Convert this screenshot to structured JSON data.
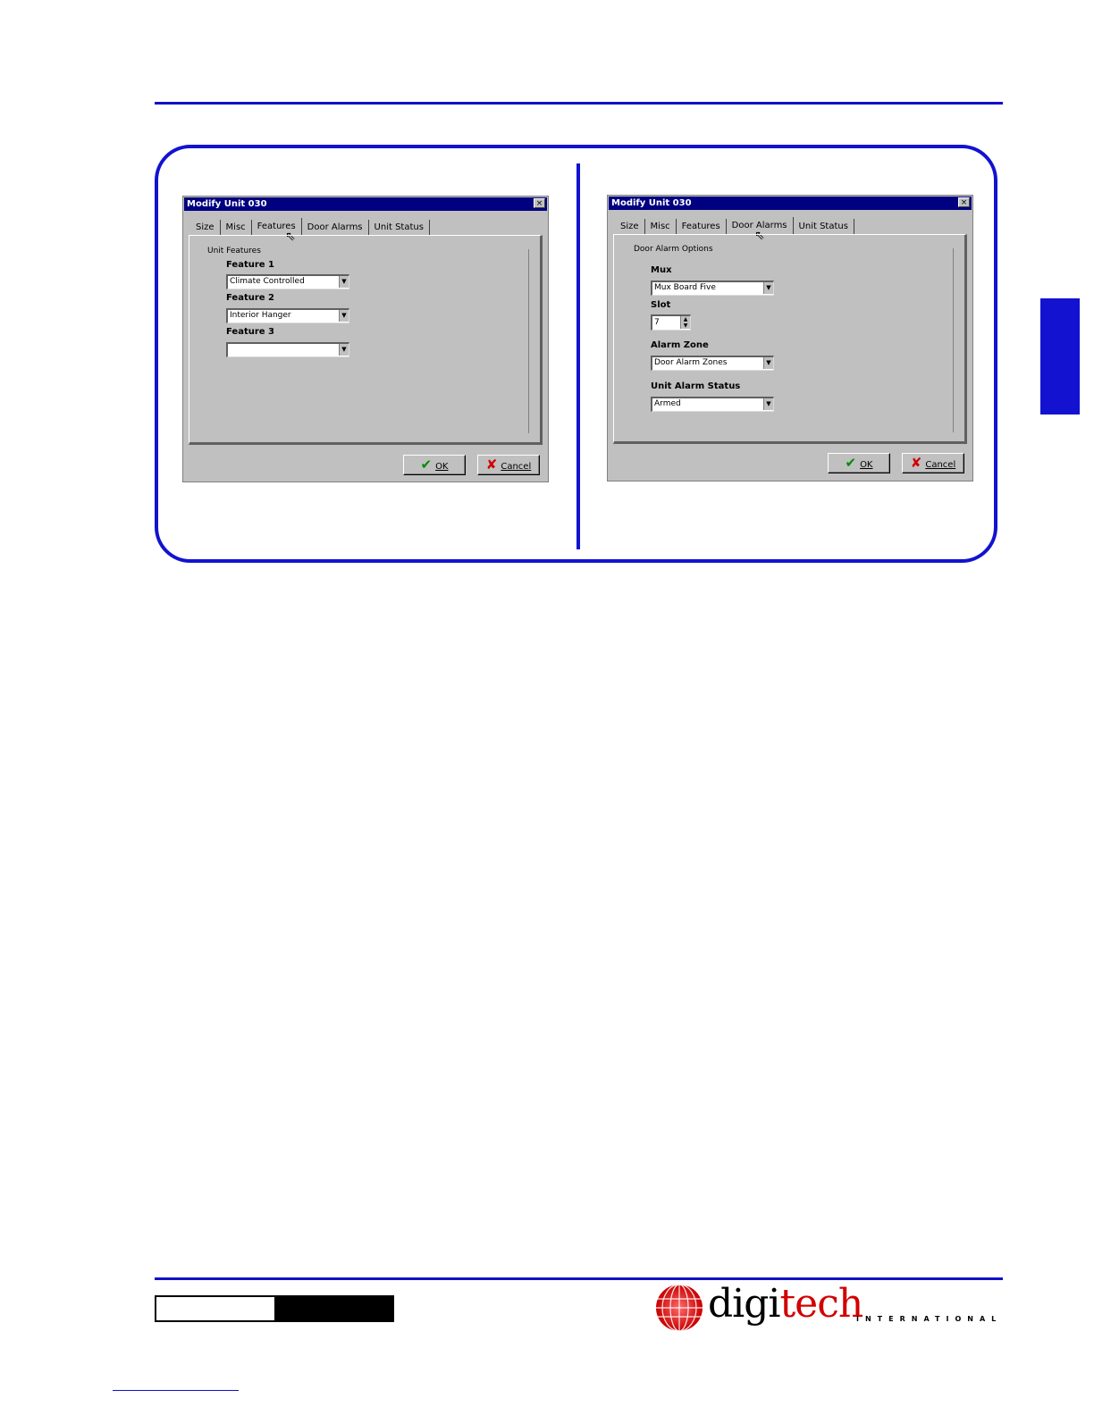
{
  "colors": {
    "accent_blue": "#1212d0",
    "title_bar": "#000080",
    "window_gray": "#c0c0c0",
    "brand_red": "#d20000"
  },
  "tabs": [
    "Size",
    "Misc",
    "Features",
    "Door Alarms",
    "Unit Status"
  ],
  "left_dialog": {
    "title": "Modify Unit 030",
    "active_tab": "Features",
    "group_title": "Unit Features",
    "feature1_label": "Feature 1",
    "feature1_value": "Climate Controlled",
    "feature2_label": "Feature 2",
    "feature2_value": "Interior Hanger",
    "feature3_label": "Feature 3",
    "feature3_value": "",
    "ok_label": "OK",
    "cancel_label": "Cancel",
    "close_glyph": "×"
  },
  "right_dialog": {
    "title": "Modify Unit 030",
    "active_tab": "Door Alarms",
    "group_title": "Door Alarm Options",
    "mux_label": "Mux",
    "mux_value": "Mux Board Five",
    "slot_label": "Slot",
    "slot_value": "7",
    "alarm_zone_label": "Alarm Zone",
    "alarm_zone_value": "Door Alarm Zones",
    "unit_alarm_status_label": "Unit Alarm Status",
    "unit_alarm_status_value": "Armed",
    "ok_label": "OK",
    "cancel_label": "Cancel",
    "close_glyph": "×"
  },
  "logo": {
    "main_prefix": "digi",
    "main_suffix": "tech",
    "sub": "INTERNATIONAL"
  }
}
